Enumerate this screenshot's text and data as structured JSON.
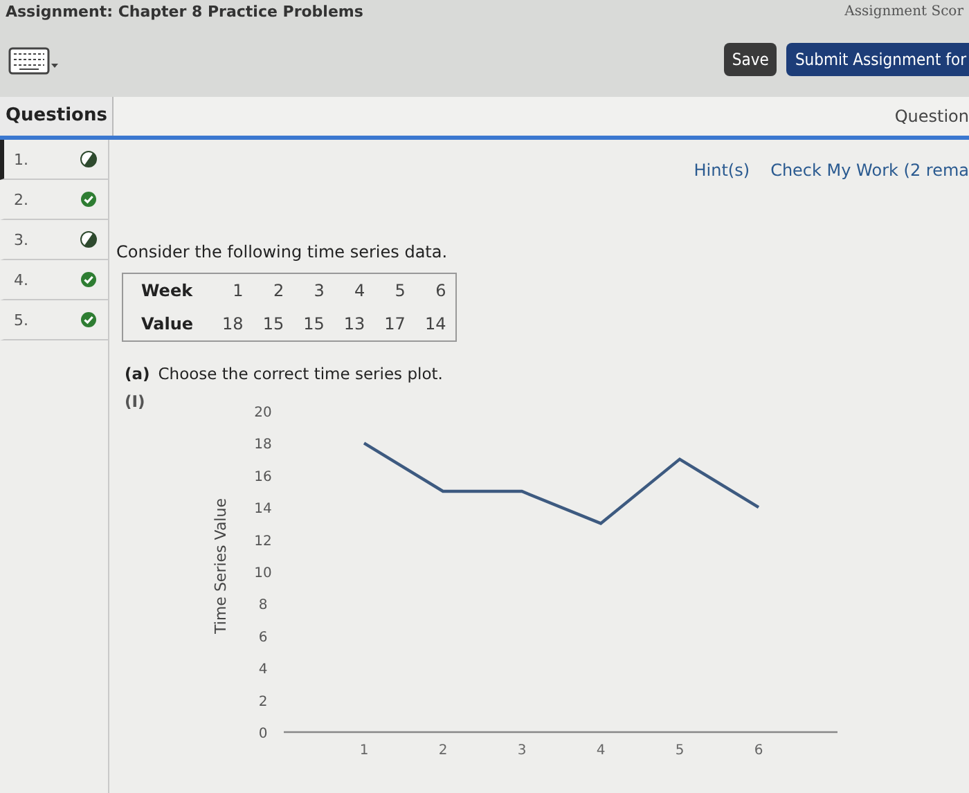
{
  "header": {
    "title": "Assignment: Chapter 8 Practice Problems",
    "score_label": "Assignment Scor"
  },
  "toolbar": {
    "buttons": [
      {
        "label": "Save",
        "kind": "dark"
      },
      {
        "label": "Submit Assignment for",
        "kind": "primary"
      }
    ]
  },
  "questions_header": {
    "left": "Questions",
    "right": "Question"
  },
  "sidebar": {
    "items": [
      {
        "label": "1.",
        "complete": false,
        "selected": true
      },
      {
        "label": "2.",
        "complete": true,
        "selected": false
      },
      {
        "label": "3.",
        "complete": false,
        "selected": false
      },
      {
        "label": "4.",
        "complete": true,
        "selected": false
      },
      {
        "label": "5.",
        "complete": true,
        "selected": false
      }
    ]
  },
  "links": [
    "Hint(s)",
    "Check My Work (2 rema"
  ],
  "prompt": "Consider the following time series data.",
  "table": {
    "rows": [
      {
        "header": "Week",
        "cells": [
          "1",
          "2",
          "3",
          "4",
          "5",
          "6"
        ]
      },
      {
        "header": "Value",
        "cells": [
          "18",
          "15",
          "15",
          "13",
          "17",
          "14"
        ]
      }
    ]
  },
  "part_a": {
    "label": "(a)",
    "text": "Choose the correct time series plot.",
    "option": "(I)",
    "chart_data": {
      "type": "line",
      "ylabel": "Time Series Value",
      "x": [
        1,
        2,
        3,
        4,
        5,
        6
      ],
      "values": [
        18,
        15,
        15,
        13,
        17,
        14
      ],
      "xlim": [
        0,
        7
      ],
      "ylim": [
        0,
        20
      ],
      "yticks": [
        0,
        2,
        4,
        6,
        8,
        10,
        12,
        14,
        16,
        18,
        20
      ],
      "xticks": [
        1,
        2,
        3,
        4,
        5,
        6
      ]
    }
  }
}
